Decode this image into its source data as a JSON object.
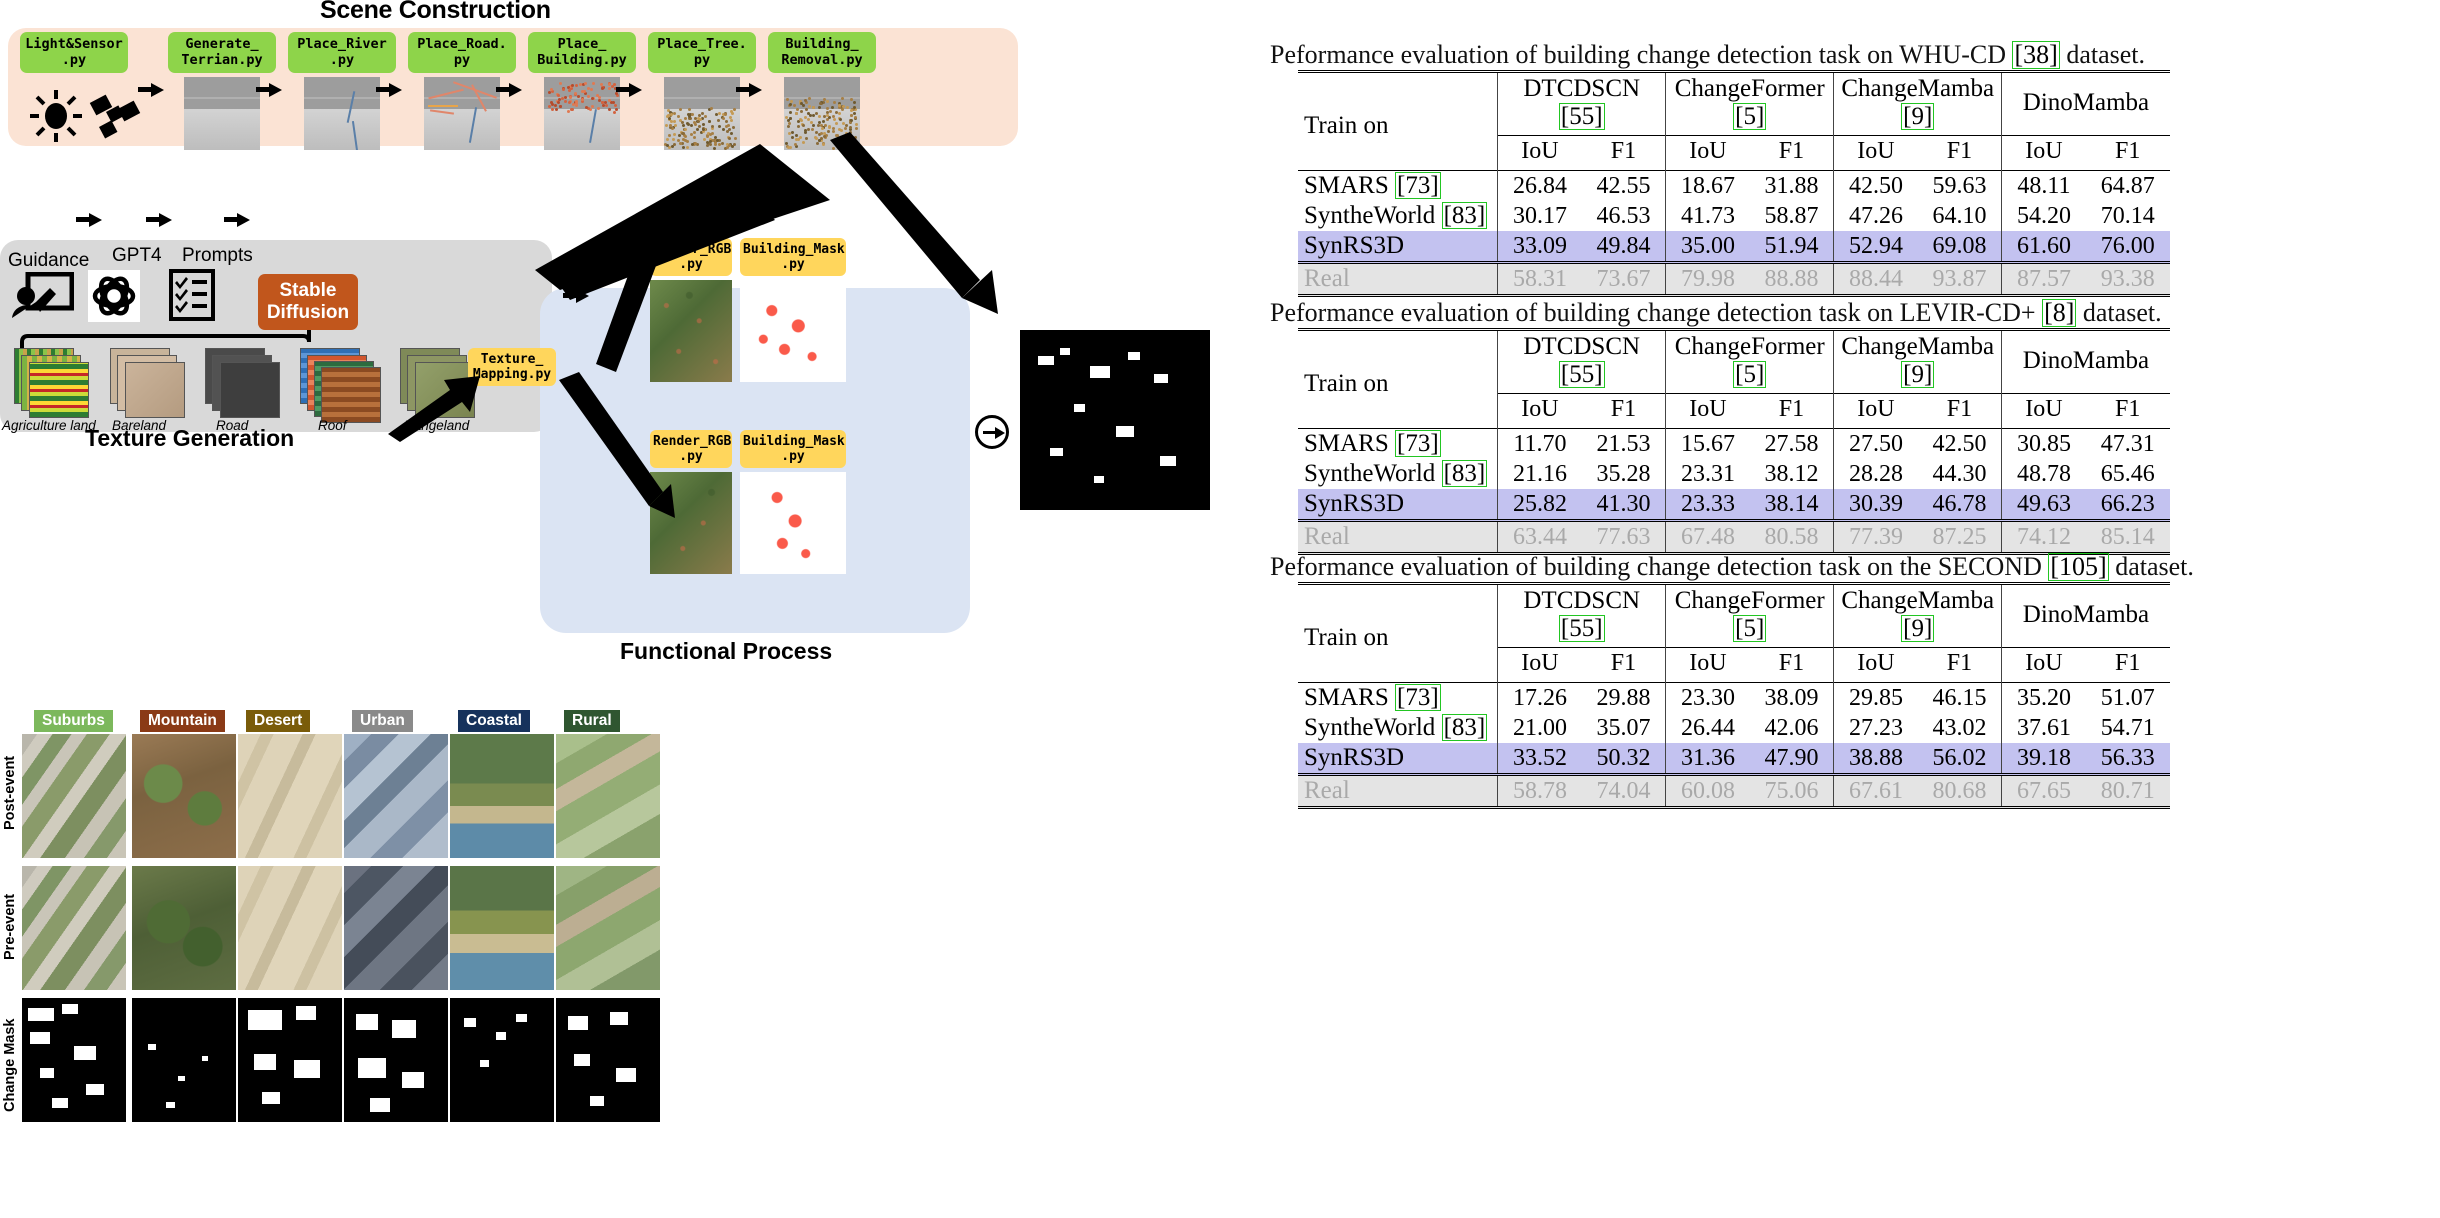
{
  "pipeline": {
    "scene_title": "Scene Construction",
    "texture_title": "Texture Generation",
    "functional_title": "Functional Process",
    "scene_steps": [
      {
        "line1": "Light&Sensor",
        "line2": ".py"
      },
      {
        "line1": "Generate_",
        "line2": "Terrian.py"
      },
      {
        "line1": "Place_River",
        "line2": ".py"
      },
      {
        "line1": "Place_Road.",
        "line2": "py"
      },
      {
        "line1": "Place_",
        "line2": "Building.py"
      },
      {
        "line1": "Place_Tree.",
        "line2": "py"
      },
      {
        "line1": "Building_",
        "line2": "Removal.py"
      }
    ],
    "texture": {
      "guidance_label": "Guidance",
      "gpt_label": "GPT4",
      "prompts_label": "Prompts",
      "sd_line1": "Stable",
      "sd_line2": "Diffusion",
      "materials": [
        "Agriculture land",
        "Bareland",
        "Road",
        "Roof",
        "Rangeland"
      ]
    },
    "functional": {
      "texture_mapping_line1": "Texture_",
      "texture_mapping_line2": "Mapping.py",
      "render_line1": "Render_RGB",
      "render_line2": ".py",
      "mask_line1": "Building_Mask",
      "mask_line2": ".py"
    }
  },
  "grid": {
    "row_labels": [
      "Post-event",
      "Pre-event",
      "Change Mask"
    ],
    "categories": [
      {
        "name": "Suburbs",
        "color": "#7cb85c"
      },
      {
        "name": "Mountain",
        "color": "#8a3a16"
      },
      {
        "name": "Desert",
        "color": "#7a5c0a"
      },
      {
        "name": "Urban",
        "color": "#8a8a8a"
      },
      {
        "name": "Coastal",
        "color": "#16325c"
      },
      {
        "name": "Rural",
        "color": "#2f5630"
      }
    ]
  },
  "tables": [
    {
      "caption_parts": {
        "pre": "Peformance evaluation of building change detection task on WHU-CD ",
        "ref": "[38]",
        "post": " dataset."
      },
      "row_header": "Train on",
      "models": [
        {
          "name": "DTCDSCN ",
          "ref": "[55]"
        },
        {
          "name": "ChangeFormer ",
          "ref": "[5]"
        },
        {
          "name": "ChangeMamba ",
          "ref": "[9]"
        },
        {
          "name": "DinoMamba",
          "ref": ""
        }
      ],
      "metrics": [
        "IoU",
        "F1"
      ],
      "rows": [
        {
          "label": "SMARS ",
          "ref": "[73]",
          "style": "normal",
          "values": [
            "26.84",
            "42.55",
            "18.67",
            "31.88",
            "42.50",
            "59.63",
            "48.11",
            "64.87"
          ],
          "bold": [
            false,
            false,
            false,
            false,
            false,
            false,
            false,
            false
          ]
        },
        {
          "label": "SyntheWorld ",
          "ref": "[83]",
          "style": "normal",
          "values": [
            "30.17",
            "46.53",
            "41.73",
            "58.87",
            "47.26",
            "64.10",
            "54.20",
            "70.14"
          ],
          "bold": [
            false,
            false,
            true,
            true,
            false,
            false,
            false,
            false
          ]
        },
        {
          "label": "SynRS3D",
          "ref": "",
          "style": "highlight",
          "values": [
            "33.09",
            "49.84",
            "35.00",
            "51.94",
            "52.94",
            "69.08",
            "61.60",
            "76.00"
          ],
          "bold": [
            true,
            true,
            false,
            false,
            true,
            true,
            true,
            true
          ]
        },
        {
          "label": "Real",
          "ref": "",
          "style": "gray",
          "values": [
            "58.31",
            "73.67",
            "79.98",
            "88.88",
            "88.44",
            "93.87",
            "87.57",
            "93.38"
          ],
          "bold": [
            false,
            false,
            false,
            false,
            false,
            false,
            false,
            false
          ]
        }
      ]
    },
    {
      "caption_parts": {
        "pre": "Peformance evaluation of building change detection task on LEVIR-CD+ ",
        "ref": "[8]",
        "post": " dataset."
      },
      "row_header": "Train on",
      "models": [
        {
          "name": "DTCDSCN ",
          "ref": "[55]"
        },
        {
          "name": "ChangeFormer ",
          "ref": "[5]"
        },
        {
          "name": "ChangeMamba ",
          "ref": "[9]"
        },
        {
          "name": "DinoMamba",
          "ref": ""
        }
      ],
      "metrics": [
        "IoU",
        "F1"
      ],
      "rows": [
        {
          "label": "SMARS ",
          "ref": "[73]",
          "style": "normal",
          "values": [
            "11.70",
            "21.53",
            "15.67",
            "27.58",
            "27.50",
            "42.50",
            "30.85",
            "47.31"
          ],
          "bold": [
            false,
            false,
            false,
            false,
            false,
            false,
            false,
            false
          ]
        },
        {
          "label": "SyntheWorld ",
          "ref": "[83]",
          "style": "normal",
          "values": [
            "21.16",
            "35.28",
            "23.31",
            "38.12",
            "28.28",
            "44.30",
            "48.78",
            "65.46"
          ],
          "bold": [
            false,
            false,
            false,
            false,
            false,
            false,
            false,
            false
          ]
        },
        {
          "label": "SynRS3D",
          "ref": "",
          "style": "highlight",
          "values": [
            "25.82",
            "41.30",
            "23.33",
            "38.14",
            "30.39",
            "46.78",
            "49.63",
            "66.23"
          ],
          "bold": [
            true,
            true,
            true,
            true,
            true,
            true,
            true,
            true
          ]
        },
        {
          "label": "Real",
          "ref": "",
          "style": "gray",
          "values": [
            "63.44",
            "77.63",
            "67.48",
            "80.58",
            "77.39",
            "87.25",
            "74.12",
            "85.14"
          ],
          "bold": [
            false,
            false,
            false,
            false,
            false,
            false,
            false,
            false
          ]
        }
      ]
    },
    {
      "caption_parts": {
        "pre": "Peformance evaluation of building change detection task on the SECOND ",
        "ref": "[105]",
        "post": " dataset."
      },
      "row_header": "Train on",
      "models": [
        {
          "name": "DTCDSCN ",
          "ref": "[55]"
        },
        {
          "name": "ChangeFormer ",
          "ref": "[5]"
        },
        {
          "name": "ChangeMamba ",
          "ref": "[9]"
        },
        {
          "name": "DinoMamba",
          "ref": ""
        }
      ],
      "metrics": [
        "IoU",
        "F1"
      ],
      "rows": [
        {
          "label": "SMARS ",
          "ref": "[73]",
          "style": "normal",
          "values": [
            "17.26",
            "29.88",
            "23.30",
            "38.09",
            "29.85",
            "46.15",
            "35.20",
            "51.07"
          ],
          "bold": [
            false,
            false,
            false,
            false,
            false,
            false,
            false,
            false
          ]
        },
        {
          "label": "SyntheWorld ",
          "ref": "[83]",
          "style": "normal",
          "values": [
            "21.00",
            "35.07",
            "26.44",
            "42.06",
            "27.23",
            "43.02",
            "37.61",
            "54.71"
          ],
          "bold": [
            false,
            false,
            false,
            false,
            false,
            false,
            false,
            false
          ]
        },
        {
          "label": "SynRS3D",
          "ref": "",
          "style": "highlight",
          "values": [
            "33.52",
            "50.32",
            "31.36",
            "47.90",
            "38.88",
            "56.02",
            "39.18",
            "56.33"
          ],
          "bold": [
            true,
            true,
            true,
            true,
            true,
            true,
            true,
            true
          ]
        },
        {
          "label": "Real",
          "ref": "",
          "style": "gray",
          "values": [
            "58.78",
            "74.04",
            "60.08",
            "75.06",
            "67.61",
            "80.68",
            "67.65",
            "80.71"
          ],
          "bold": [
            false,
            false,
            false,
            false,
            false,
            false,
            false,
            false
          ]
        }
      ]
    }
  ],
  "colors": {
    "scene_panel": "#fbe3d4",
    "texture_panel": "#d9d9d9",
    "functional_panel": "#dbe4f3",
    "code_chip": "#8ed44a",
    "yellow_chip": "#ffd65c",
    "stable_diffusion": "#c1561c",
    "highlight_row": "#c3c2f0",
    "ref_box": "#22c522"
  }
}
